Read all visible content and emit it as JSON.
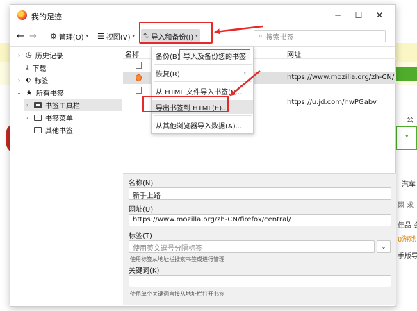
{
  "window": {
    "title": "我的足迹",
    "minimize_icon": "minimize-icon",
    "maximize_icon": "maximize-icon",
    "close_icon": "close-icon"
  },
  "toolbar": {
    "organize_label": "管理(O)",
    "views_label": "视图(V)",
    "import_backup_label": "导入和备份(I)",
    "search_placeholder": "搜索书签"
  },
  "sidebar": {
    "items": [
      {
        "label": "历史记录"
      },
      {
        "label": "下载"
      },
      {
        "label": "标签"
      },
      {
        "label": "所有书签"
      },
      {
        "label": "书签工具栏"
      },
      {
        "label": "书签菜单"
      },
      {
        "label": "其他书签"
      }
    ]
  },
  "list": {
    "col_name": "名称",
    "col_url": "网址",
    "rows": [
      {
        "url": ""
      },
      {
        "url": "https://www.mozilla.org/zh-CN/"
      },
      {
        "url": ""
      },
      {
        "url": "https://u.jd.com/nwPGabv"
      }
    ]
  },
  "menu": {
    "items": [
      {
        "label": "备份(B)..."
      },
      {
        "label": "恢复(R)"
      },
      {
        "label": "从 HTML 文件导入书签(I)..."
      },
      {
        "label": "导出书签到 HTML(E)..."
      },
      {
        "label": "从其他浏览器导入数据(A)..."
      }
    ],
    "tooltip": "导入及备份您的书签"
  },
  "details": {
    "name_label": "名称(N)",
    "name_value": "新手上路",
    "url_label": "网址(U)",
    "url_value": "https://www.mozilla.org/zh-CN/firefox/central/",
    "tags_label": "标签(T)",
    "tags_placeholder": "使用英文逗号分隔标签",
    "tags_hint": "使用标签从地址栏搜索书签或进行管理",
    "keyword_label": "关键词(K)",
    "keyword_value": "",
    "keyword_hint": "使用单个关键词直接从地址栏打开书签"
  },
  "background_page": {
    "text1": "公",
    "text2": "汽车",
    "text3": "网 求",
    "text4": "佳品 会",
    "text5": "0游戏",
    "text6": "手版导航"
  },
  "colors": {
    "annotation_red": "#e52a2a",
    "page_green": "#4fad2b",
    "page_yellow": "#fbf7c5"
  }
}
